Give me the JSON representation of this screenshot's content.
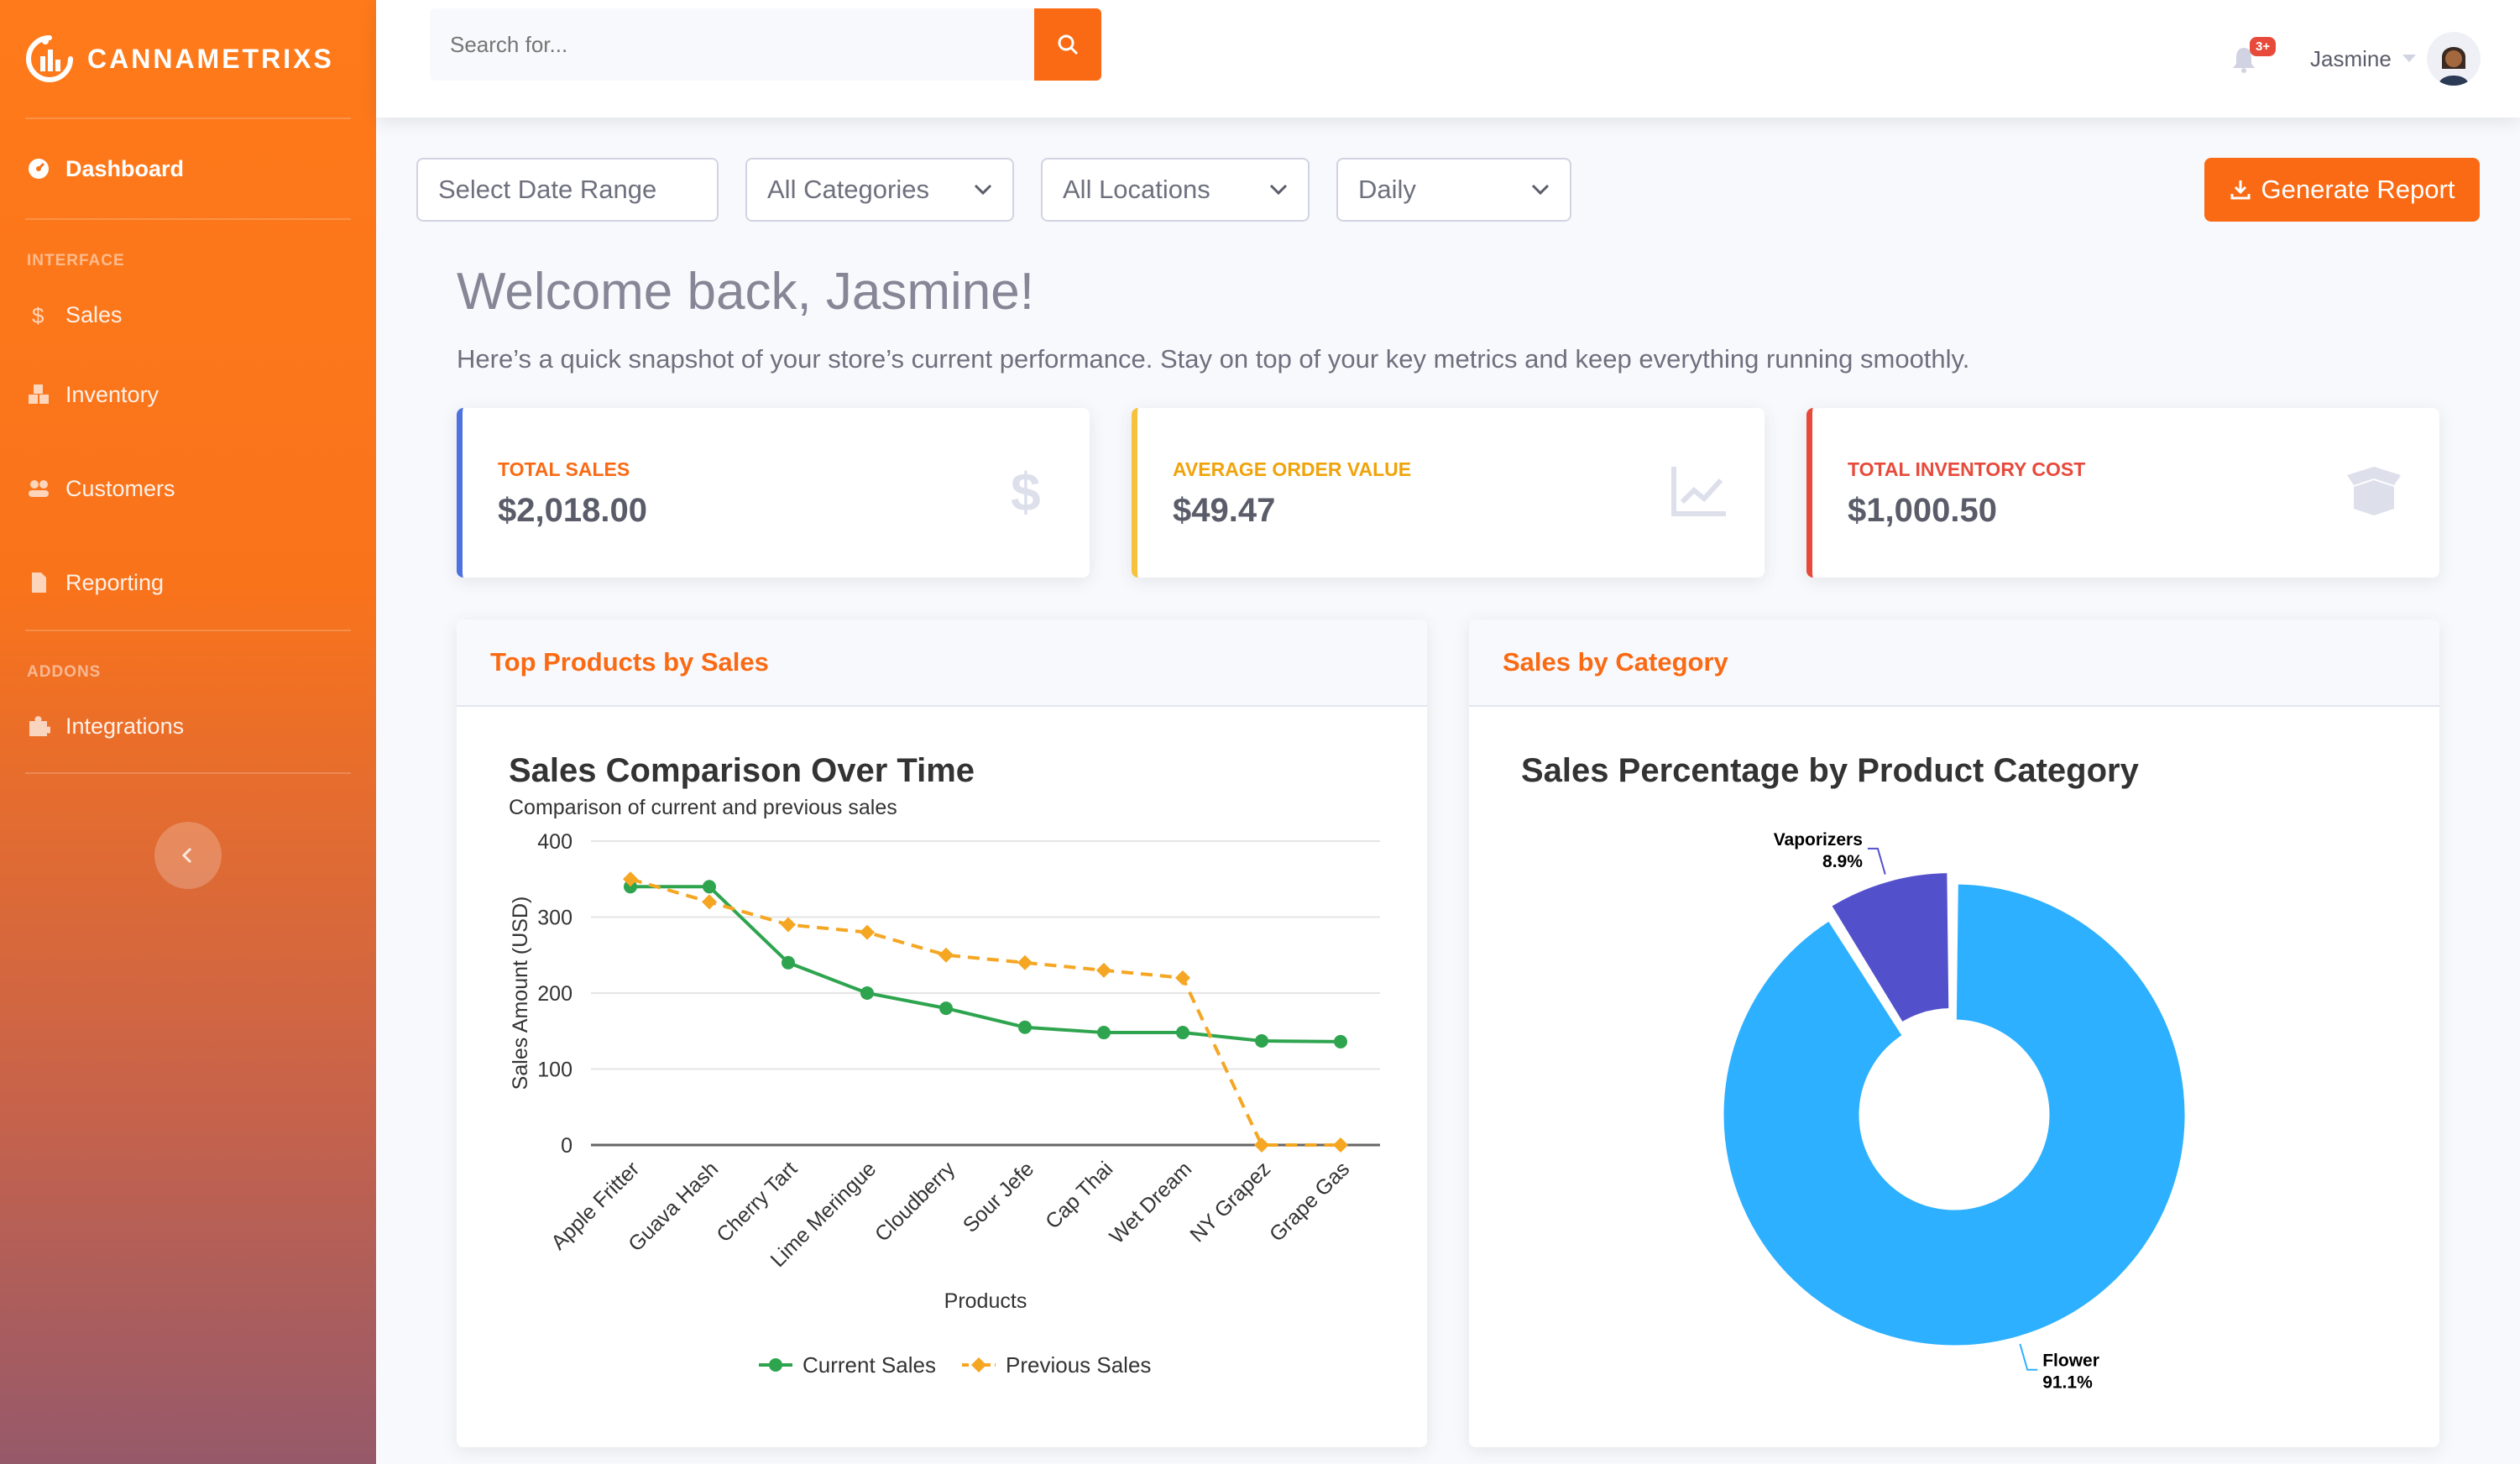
{
  "brand": {
    "name": "CANNAMETRIXS"
  },
  "sidebar": {
    "dashboard": "Dashboard",
    "section_interface": "INTERFACE",
    "items": [
      {
        "label": "Sales",
        "icon": "dollar-icon"
      },
      {
        "label": "Inventory",
        "icon": "boxes-icon"
      },
      {
        "label": "Customers",
        "icon": "users-icon"
      },
      {
        "label": "Reporting",
        "icon": "file-icon"
      }
    ],
    "section_addons": "ADDONS",
    "addons": [
      {
        "label": "Integrations",
        "icon": "puzzle-icon"
      }
    ]
  },
  "topbar": {
    "search_placeholder": "Search for...",
    "notification_count": "3+",
    "user_name": "Jasmine"
  },
  "filters": {
    "date_range": "Select Date Range",
    "categories": "All Categories",
    "locations": "All Locations",
    "period": "Daily",
    "generate": "Generate Report"
  },
  "welcome": {
    "title": "Welcome back, Jasmine!",
    "subtitle": "Here’s a quick snapshot of your store’s current performance. Stay on top of your key metrics and keep everything running smoothly."
  },
  "kpis": [
    {
      "label": "TOTAL SALES",
      "value": "$2,018.00",
      "color": "#4e73df",
      "label_color": "#fa6a14"
    },
    {
      "label": "AVERAGE ORDER VALUE",
      "value": "$49.47",
      "color": "#f6c23e",
      "label_color": "#f0a30a"
    },
    {
      "label": "TOTAL INVENTORY COST",
      "value": "$1,000.50",
      "color": "#e74a3b",
      "label_color": "#e74a3b"
    }
  ],
  "cards": {
    "top_products": "Top Products by Sales",
    "by_category": "Sales by Category"
  },
  "chart_data": [
    {
      "type": "line",
      "title": "Sales Comparison Over Time",
      "subtitle": "Comparison of current and previous sales",
      "xlabel": "Products",
      "ylabel": "Sales Amount (USD)",
      "ylim": [
        0,
        400
      ],
      "yticks": [
        0,
        100,
        200,
        300,
        400
      ],
      "categories": [
        "Apple Fritter",
        "Guava Hash",
        "Cherry Tart",
        "Lime Meringue",
        "Cloudberry",
        "Sour Jefe",
        "Cap Thai",
        "Wet Dream",
        "NY Grapez",
        "Grape Gas"
      ],
      "series": [
        {
          "name": "Current Sales",
          "color": "#2ea44f",
          "values": [
            340,
            340,
            240,
            200,
            180,
            155,
            148,
            148,
            137,
            136
          ]
        },
        {
          "name": "Previous Sales",
          "color": "#f5a623",
          "values": [
            350,
            320,
            290,
            280,
            250,
            240,
            230,
            220,
            0,
            0
          ]
        }
      ],
      "legend": "bottom"
    },
    {
      "type": "pie",
      "title": "Sales Percentage by Product Category",
      "slices": [
        {
          "label": "Flower",
          "value": 91.1,
          "pct": "91.1%",
          "color": "#2db0ff"
        },
        {
          "label": "Vaporizers",
          "value": 8.9,
          "pct": "8.9%",
          "color": "#5350cc"
        }
      ]
    }
  ]
}
